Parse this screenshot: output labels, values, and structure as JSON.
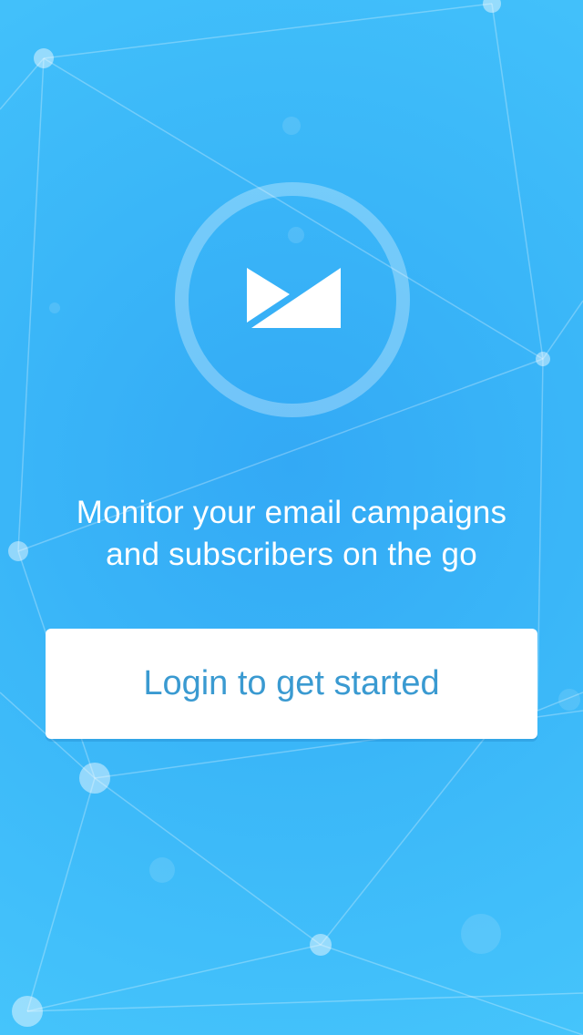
{
  "app": {
    "logo_icon": "envelope-icon",
    "accent_color": "#3ab4f7"
  },
  "tagline": {
    "line1": "Monitor your email campaigns",
    "line2": "and subscribers on the go"
  },
  "login_button": {
    "label": "Login to get started",
    "text_color": "#3a9ad1"
  }
}
